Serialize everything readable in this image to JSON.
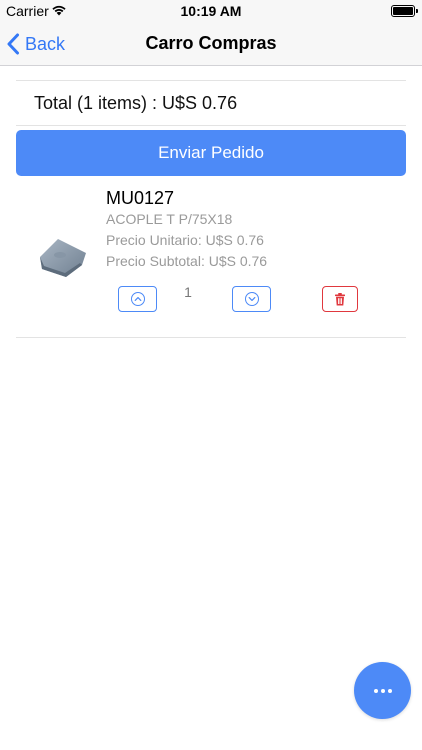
{
  "status_bar": {
    "carrier": "Carrier",
    "time": "10:19 AM",
    "wifi_icon": "wifi-icon",
    "battery_icon": "battery-icon"
  },
  "nav": {
    "back_label": "Back",
    "back_icon": "chevron-left-icon",
    "title": "Carro Compras"
  },
  "cart": {
    "total_text": "Total (1 items) : U$S 0.76",
    "send_button_label": "Enviar Pedido"
  },
  "items": [
    {
      "code": "MU0127",
      "description": "ACOPLE T P/75X18",
      "unit_price": "Precio Unitario: U$S 0.76",
      "subtotal": "Precio Subtotal: U$S 0.76",
      "quantity": "1",
      "increase_icon": "chevron-up-circle-icon",
      "decrease_icon": "chevron-down-circle-icon",
      "delete_icon": "trash-icon"
    }
  ],
  "fab": {
    "icon": "more-dots-icon"
  },
  "colors": {
    "accent": "#4d8af7",
    "ios_blue": "#3478f6",
    "delete_red": "#e0383e",
    "secondary_text": "#9a9a9a"
  }
}
